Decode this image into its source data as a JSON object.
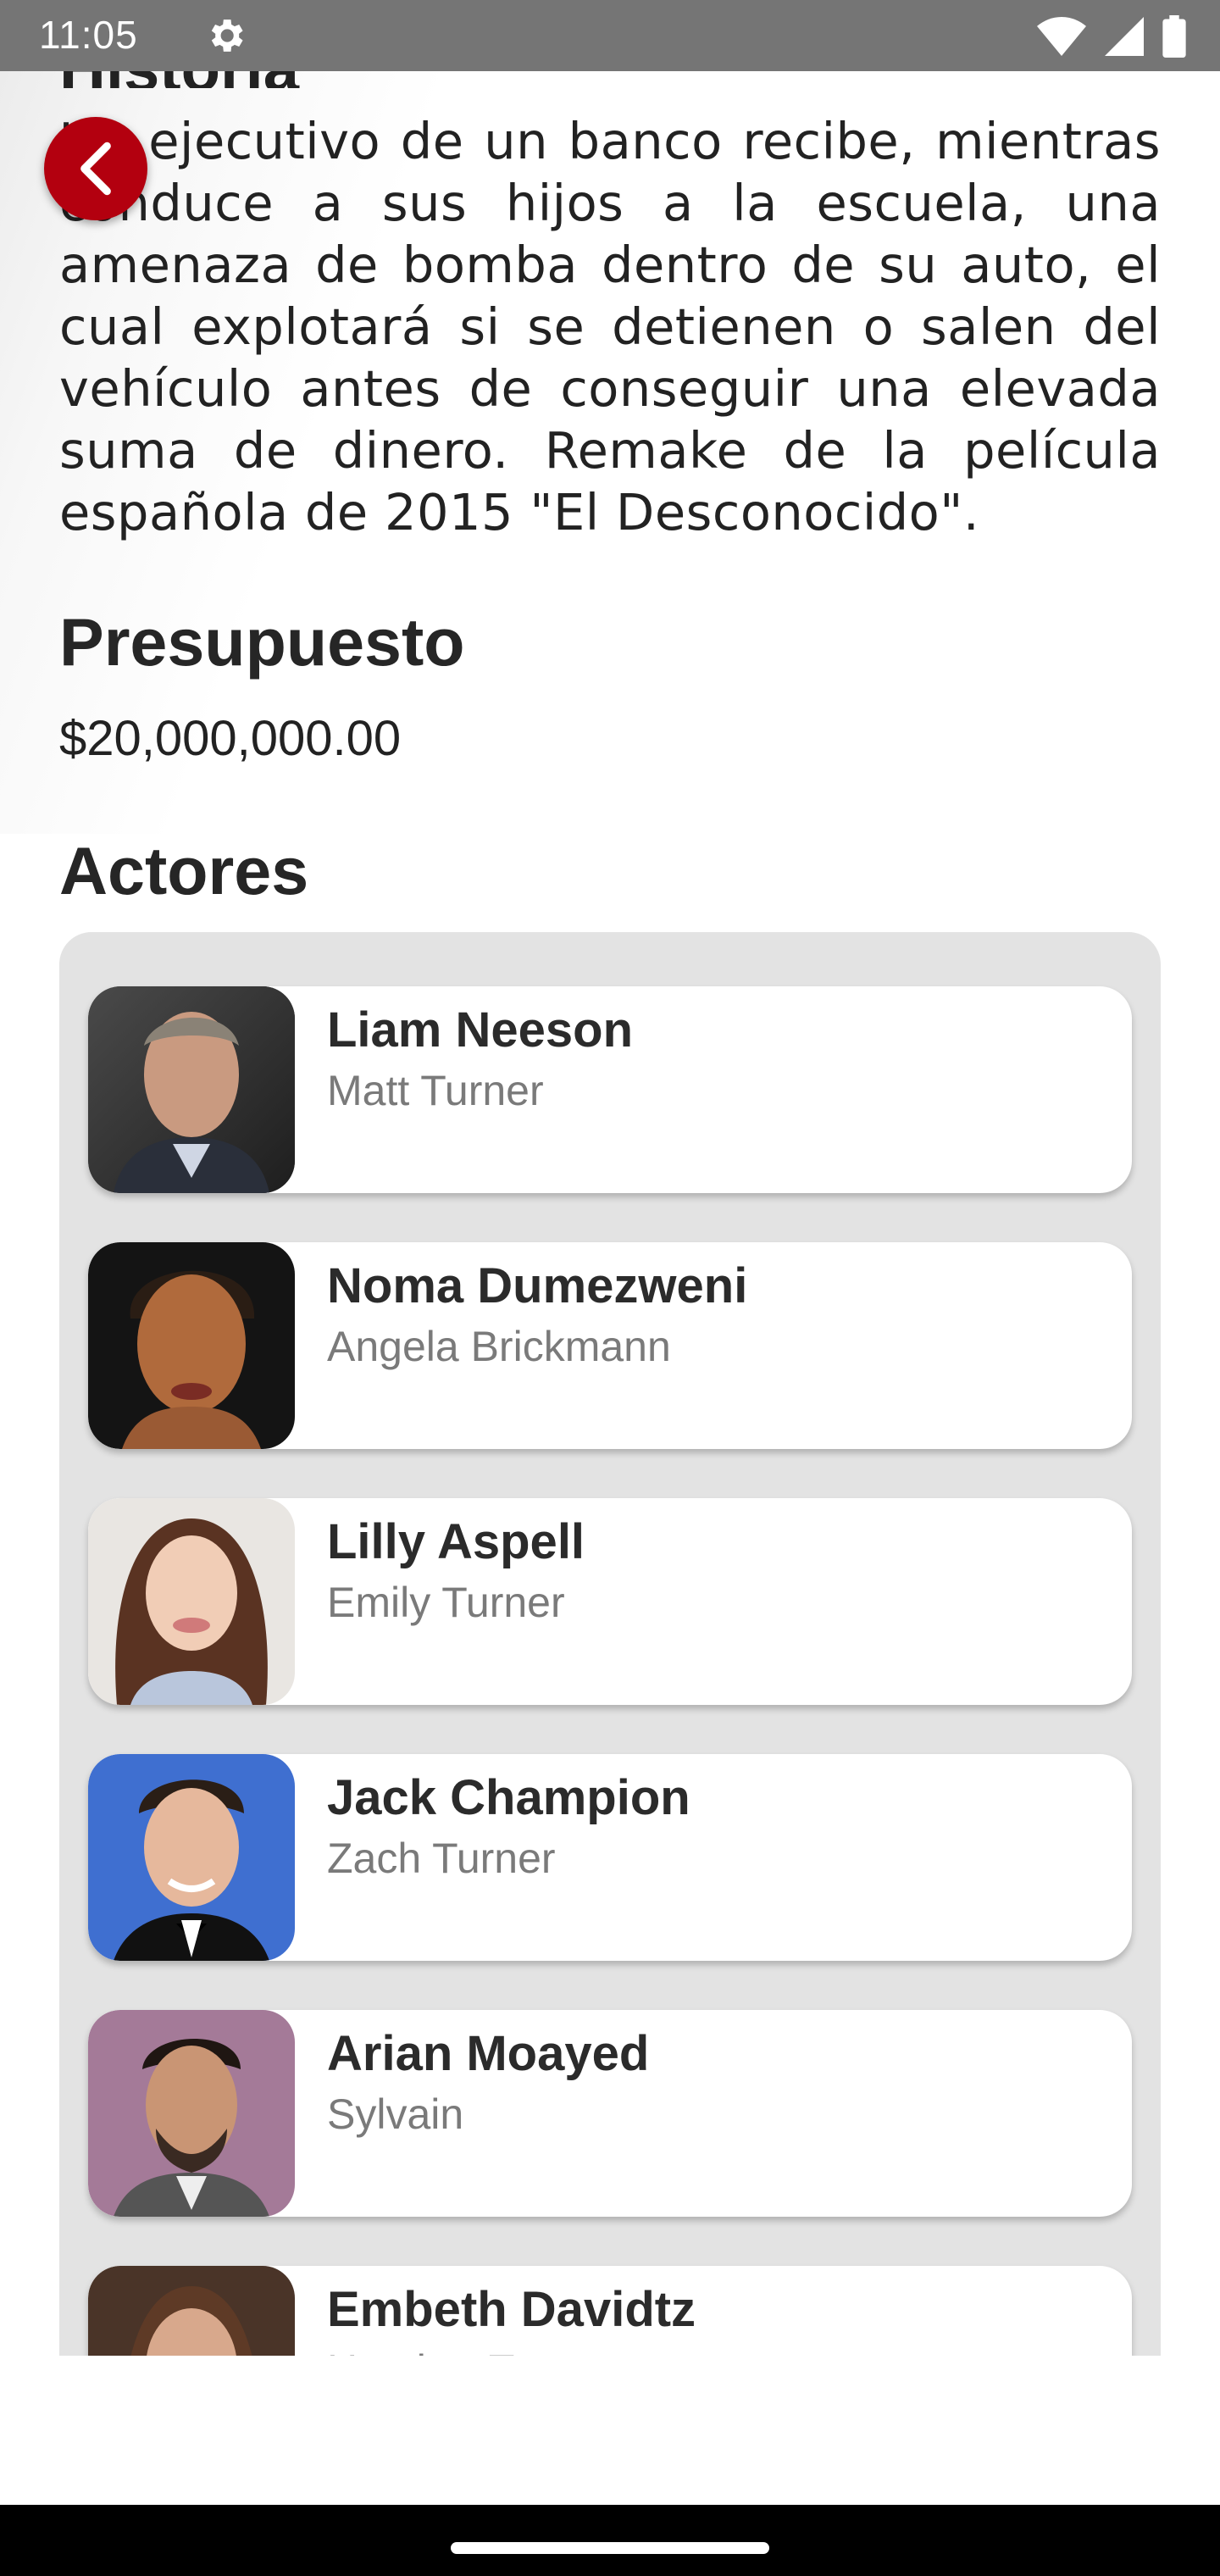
{
  "status_bar": {
    "time": "11:05",
    "icons": [
      "settings-gear-icon",
      "wifi-icon",
      "cell-signal-icon",
      "battery-icon"
    ]
  },
  "story": {
    "heading": "Historia",
    "text": "Un ejecutivo de un banco recibe, mientras conduce a sus hijos a la escuela, una amenaza de bomba dentro de su auto, el cual explotará si se detienen o salen del vehículo antes de conseguir una elevada suma de dinero. Remake de la película española de 2015 \"El Desconocido\"."
  },
  "budget": {
    "heading": "Presupuesto",
    "value": "$20,000,000.00"
  },
  "actors": {
    "heading": "Actores",
    "list": [
      {
        "name": "Liam Neeson",
        "role": "Matt Turner"
      },
      {
        "name": "Noma Dumezweni",
        "role": "Angela Brickmann"
      },
      {
        "name": "Lilly Aspell",
        "role": "Emily Turner"
      },
      {
        "name": "Jack Champion",
        "role": "Zach Turner"
      },
      {
        "name": "Arian Moayed",
        "role": "Sylvain"
      },
      {
        "name": "Embeth Davidtz",
        "role": "Heather Turner"
      }
    ]
  },
  "colors": {
    "accent": "#b3000f",
    "status_bar": "#757575",
    "panel": "#e3e3e3"
  }
}
